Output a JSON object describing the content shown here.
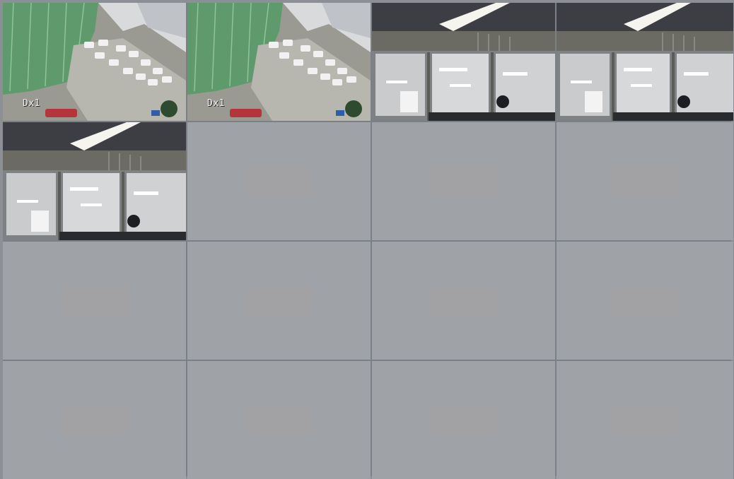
{
  "window": {
    "title": ""
  },
  "grid": {
    "columns": 4,
    "rows": 4,
    "channels": [
      {
        "id": 1,
        "feed": "outdoor-parking-lot",
        "overlay_label": "Dx1"
      },
      {
        "id": 2,
        "feed": "outdoor-parking-lot",
        "overlay_label": "Dx1"
      },
      {
        "id": 3,
        "feed": "indoor-office",
        "overlay_label": ""
      },
      {
        "id": 4,
        "feed": "indoor-office",
        "overlay_label": ""
      },
      {
        "id": 5,
        "feed": "indoor-office",
        "overlay_label": ""
      },
      {
        "id": 6,
        "feed": "no-signal",
        "overlay_label": ""
      },
      {
        "id": 7,
        "feed": "no-signal",
        "overlay_label": ""
      },
      {
        "id": 8,
        "feed": "no-signal",
        "overlay_label": ""
      },
      {
        "id": 9,
        "feed": "no-signal",
        "overlay_label": ""
      },
      {
        "id": 10,
        "feed": "no-signal",
        "overlay_label": ""
      },
      {
        "id": 11,
        "feed": "no-signal",
        "overlay_label": ""
      },
      {
        "id": 12,
        "feed": "no-signal",
        "overlay_label": ""
      },
      {
        "id": 13,
        "feed": "no-signal",
        "overlay_label": ""
      },
      {
        "id": 14,
        "feed": "no-signal",
        "overlay_label": ""
      },
      {
        "id": 15,
        "feed": "no-signal",
        "overlay_label": ""
      },
      {
        "id": 16,
        "feed": "no-signal",
        "overlay_label": ""
      }
    ]
  },
  "colors": {
    "empty_tile": "#9fa3a8",
    "grid_line": "#7b8086",
    "building_green": "#5f9a6c",
    "office_ceiling": "#3d3e44"
  }
}
